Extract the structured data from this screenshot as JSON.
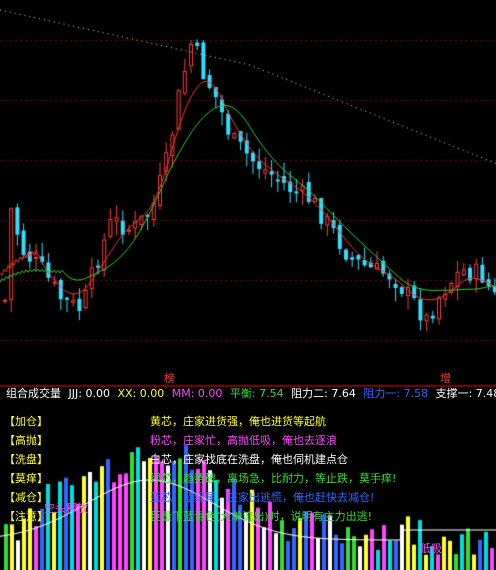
{
  "colors": {
    "background": "#000000",
    "up": "#ff3b3b",
    "down": "#33ddff",
    "ma_red": "#ff3030",
    "ma_green": "#33cc33",
    "dotted": "#e8e8a0",
    "yellow": "#ffff33",
    "magenta": "#ff44ff",
    "white": "#ffffff",
    "blue": "#3366ff"
  },
  "markers": {
    "bottom_left": "榜",
    "bottom_right": "增"
  },
  "status": {
    "indicator_name": "组合成交量",
    "jjj_label": "JJJ:",
    "jjj_value": "0.00",
    "xx_label": "XX:",
    "xx_value": "0.00",
    "mm_label": "MM:",
    "mm_value": "0.00",
    "balance_label": "平衡:",
    "balance_value": "7.54",
    "resist2_label": "阻力二:",
    "resist2_value": "7.64",
    "resist1_label": "阻力一:",
    "resist1_value": "7.58",
    "support1_label": "支撑一:",
    "support1_value": "7.48"
  },
  "legend": [
    {
      "label": "【加仓】",
      "note": "黄芯，庄家进货强，俺也进货等起航",
      "note_color": "#ffff33"
    },
    {
      "label": "【高抛】",
      "note": "粉芯，庄家忙，高抛低吸，俺也去逐浪",
      "note_color": "#ff44ff"
    },
    {
      "label": "【洗盘】",
      "note": "白芯，庄家找底在洗盘，俺也伺机建点仓",
      "note_color": "#ffffff"
    },
    {
      "label": "【莫痒】",
      "note": "绿芯，趋势破，离场急，比耐力，等止跌，莫手痒!",
      "note_color": "#33dd33"
    },
    {
      "label": "【减仓】",
      "note": "蓝芯，蓝绿尾，庄家出逃慌，俺也赶快去减仓!",
      "note_color": "#3366ff"
    },
    {
      "label": "【注意】",
      "note": "巨量下蓝青色(大单流出)时，说明有主力出逃!",
      "note_color": "#33dd33"
    }
  ],
  "sub_labels": {
    "left": "空头释放",
    "right": "低吸"
  }
}
